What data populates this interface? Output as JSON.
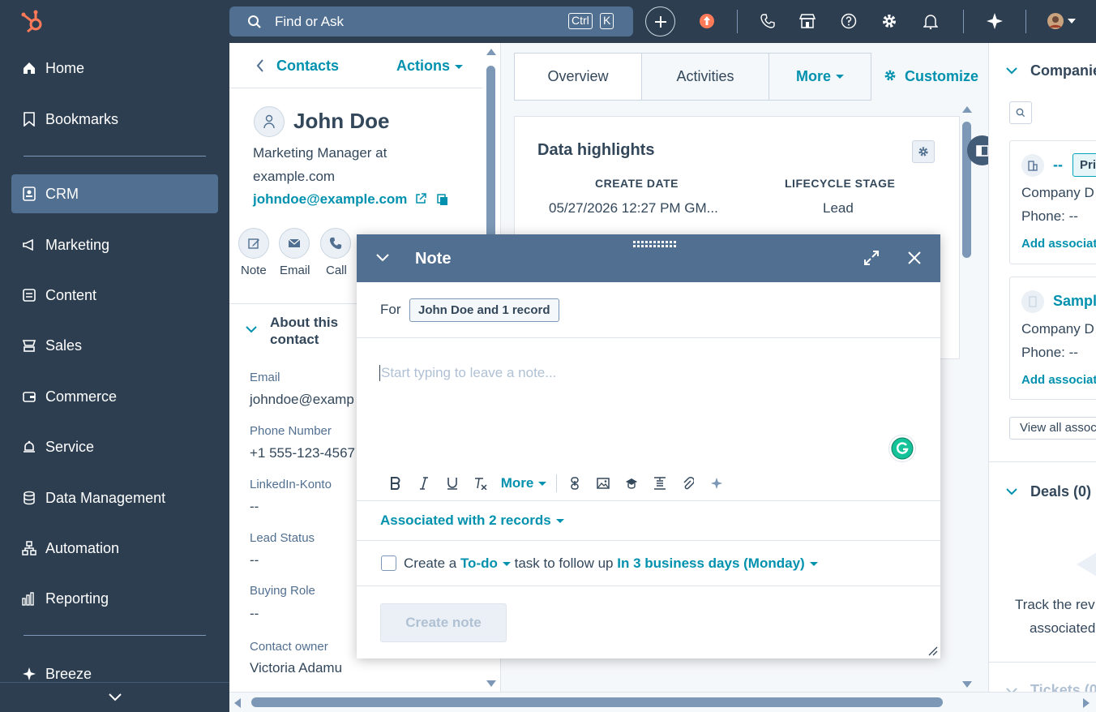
{
  "sidebar": {
    "items": [
      {
        "label": "Home",
        "icon": "home-icon"
      },
      {
        "label": "Bookmarks",
        "icon": "bookmark-icon"
      },
      {
        "label": "CRM",
        "icon": "crm-icon"
      },
      {
        "label": "Marketing",
        "icon": "megaphone-icon"
      },
      {
        "label": "Content",
        "icon": "content-icon"
      },
      {
        "label": "Sales",
        "icon": "sales-icon"
      },
      {
        "label": "Commerce",
        "icon": "wallet-icon"
      },
      {
        "label": "Service",
        "icon": "bell-service-icon"
      },
      {
        "label": "Data Management",
        "icon": "database-icon"
      },
      {
        "label": "Automation",
        "icon": "automation-icon"
      },
      {
        "label": "Reporting",
        "icon": "chart-icon"
      },
      {
        "label": "Breeze",
        "icon": "sparkle-icon"
      }
    ]
  },
  "topbar": {
    "search_placeholder": "Find or Ask",
    "kbd_ctrl": "Ctrl",
    "kbd_k": "K"
  },
  "contact": {
    "back_label": "Contacts",
    "actions_label": "Actions",
    "name": "John Doe",
    "title_line1": "Marketing Manager at",
    "title_line2": "example.com",
    "email": "johndoe@example.com",
    "action_buttons": [
      "Note",
      "Email",
      "Call"
    ],
    "about_title_line1": "About this",
    "about_title_line2": "contact",
    "properties": [
      {
        "label": "Email",
        "value": "johndoe@examp"
      },
      {
        "label": "Phone Number",
        "value": "+1 555-123-4567"
      },
      {
        "label": "LinkedIn-Konto",
        "value": "--"
      },
      {
        "label": "Lead Status",
        "value": "--"
      },
      {
        "label": "Buying Role",
        "value": "--"
      },
      {
        "label": "Contact owner",
        "value": "Victoria Adamu"
      }
    ]
  },
  "middle": {
    "tabs": [
      "Overview",
      "Activities",
      "More"
    ],
    "customize_label": "Customize",
    "highlights_title": "Data highlights",
    "create_date_label": "CREATE DATE",
    "create_date_value": "05/27/2026 12:27 PM GM...",
    "lifecycle_label": "LIFECYCLE STAGE",
    "lifecycle_value": "Lead"
  },
  "right": {
    "companies_title": "Companie",
    "company1_name": "--",
    "company1_badge": "Pri",
    "company_domain_label": "Company D",
    "phone_label": "Phone: --",
    "add_assoc1": "Add associatio",
    "company2_name": "Sample",
    "add_assoc2": "Add associati",
    "view_all": "View all assoc",
    "deals_title": "Deals (0)",
    "track_line1": "Track the rev",
    "track_line2": "associated",
    "tickets_title": "Tickets (0"
  },
  "note": {
    "title": "Note",
    "for_label": "For",
    "for_chip": "John Doe and 1 record",
    "placeholder": "Start typing to leave a note...",
    "more_label": "More",
    "associated": "Associated with 2 records",
    "task_prefix": "Create a",
    "task_type": "To-do",
    "task_middle": "task to follow up",
    "task_due": "In 3 business days (Monday)",
    "create_button": "Create note"
  },
  "colors": {
    "sidebar_bg": "#2d3e50",
    "accent": "#0091ae",
    "modal_header": "#516f90"
  }
}
